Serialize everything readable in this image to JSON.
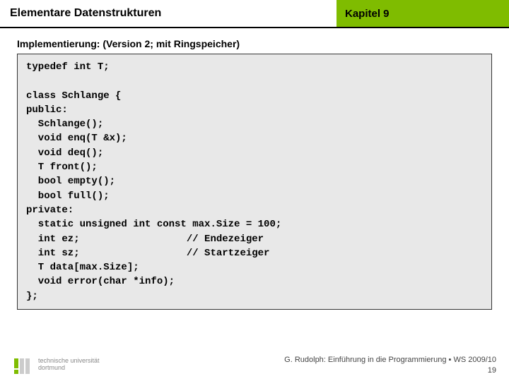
{
  "header": {
    "left": "Elementare Datenstrukturen",
    "right": "Kapitel 9"
  },
  "subtitle": "Implementierung: (Version 2; mit Ringspeicher)",
  "code": "typedef int T;\n\nclass Schlange {\npublic:\n  Schlange();\n  void enq(T &x);\n  void deq();\n  T front();\n  bool empty();\n  bool full();\nprivate:\n  static unsigned int const max.Size = 100;\n  int ez;                  // Endezeiger\n  int sz;                  // Startzeiger\n  T data[max.Size];\n  void error(char *info);\n};",
  "logo": {
    "line1": "technische universität",
    "line2": "dortmund"
  },
  "credit": {
    "line1": "G. Rudolph: Einführung in die Programmierung ▪ WS 2009/10",
    "line2": "19"
  }
}
